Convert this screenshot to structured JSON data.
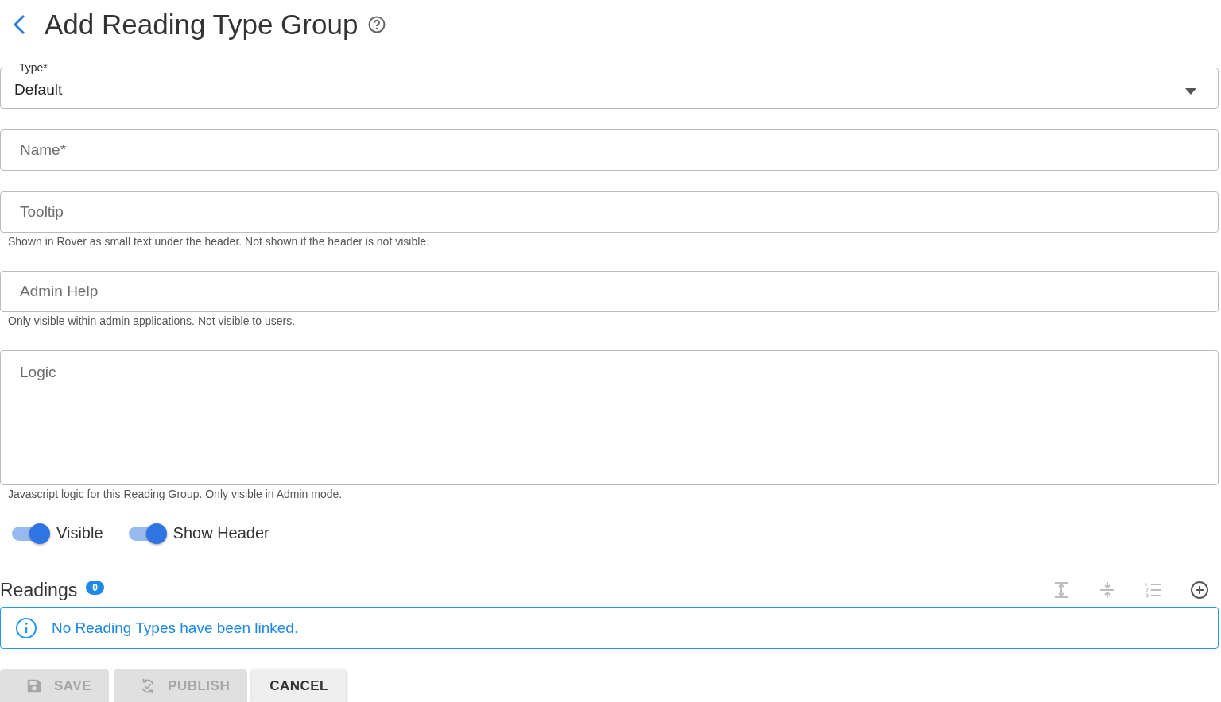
{
  "header": {
    "title": "Add Reading Type Group"
  },
  "type_field": {
    "label": "Type*",
    "value": "Default"
  },
  "fields": [
    {
      "kind": "text",
      "placeholder": "Name*"
    },
    {
      "kind": "text",
      "placeholder": "Tooltip",
      "helper": "Shown in Rover as small text under the header. Not shown if the header is not visible."
    },
    {
      "kind": "text",
      "placeholder": "Admin Help",
      "helper": "Only visible within admin applications. Not visible to users."
    },
    {
      "kind": "textarea",
      "placeholder": "Logic",
      "helper": "Javascript logic for this Reading Group. Only visible in Admin mode."
    }
  ],
  "toggles": [
    {
      "label": "Visible",
      "on": true
    },
    {
      "label": "Show Header",
      "on": true
    }
  ],
  "readings": {
    "title": "Readings",
    "count": "0",
    "toolbar": [
      {
        "kind": "expand",
        "disabled": true
      },
      {
        "kind": "collapse",
        "disabled": true
      },
      {
        "kind": "numbered",
        "disabled": true
      },
      {
        "kind": "add",
        "disabled": false
      }
    ],
    "message": "No Reading Types have been linked."
  },
  "buttons": [
    {
      "kind": "save",
      "label": "SAVE",
      "disabled": true
    },
    {
      "kind": "publish",
      "label": "PUBLISH",
      "disabled": true
    },
    {
      "kind": "cancel",
      "label": "CANCEL",
      "disabled": false
    }
  ]
}
